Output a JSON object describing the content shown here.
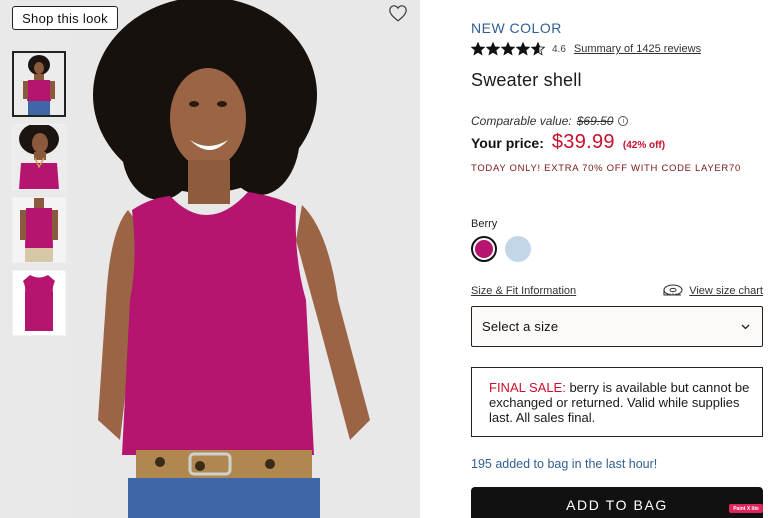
{
  "gallery": {
    "shop_look_label": "Shop this look",
    "favorite_icon": "heart-outline-icon",
    "thumbnails": [
      {
        "name": "thumb-model-front",
        "active": true
      },
      {
        "name": "thumb-model-closeup",
        "active": false
      },
      {
        "name": "thumb-model-back",
        "active": false
      },
      {
        "name": "thumb-flat-lay",
        "active": false
      }
    ],
    "product_color": "#b5146f"
  },
  "product": {
    "badge": "NEW COLOR",
    "rating_value": "4.6",
    "rating_stars": 4.6,
    "reviews_link": "Summary of 1425 reviews",
    "title": "Sweater shell"
  },
  "pricing": {
    "comparable_label": "Comparable value:",
    "comparable_price": "$69.50",
    "your_price_label": "Your price:",
    "price": "$39.99",
    "discount": "(42% off)",
    "promo": "TODAY ONLY! EXTRA 70% OFF WITH CODE LAYER70",
    "price_color": "#c8102e"
  },
  "color": {
    "selected_name": "Berry",
    "swatches": [
      {
        "name": "Berry",
        "hex": "#b5146f",
        "selected": true
      },
      {
        "name": "Light blue",
        "hex": "#c3d6e8",
        "selected": false
      }
    ]
  },
  "size": {
    "fit_link": "Size & Fit Information",
    "chart_link": "View size chart",
    "select_placeholder": "Select a size"
  },
  "notice": {
    "label": "FINAL SALE:",
    "text": " berry is available but cannot be exchanged or returned. Valid while supplies last. All sales final."
  },
  "social_proof": "195 added to bag in the last hour!",
  "cta": {
    "add_to_bag": "ADD TO BAG"
  },
  "extension_tag": "Paint X lite"
}
